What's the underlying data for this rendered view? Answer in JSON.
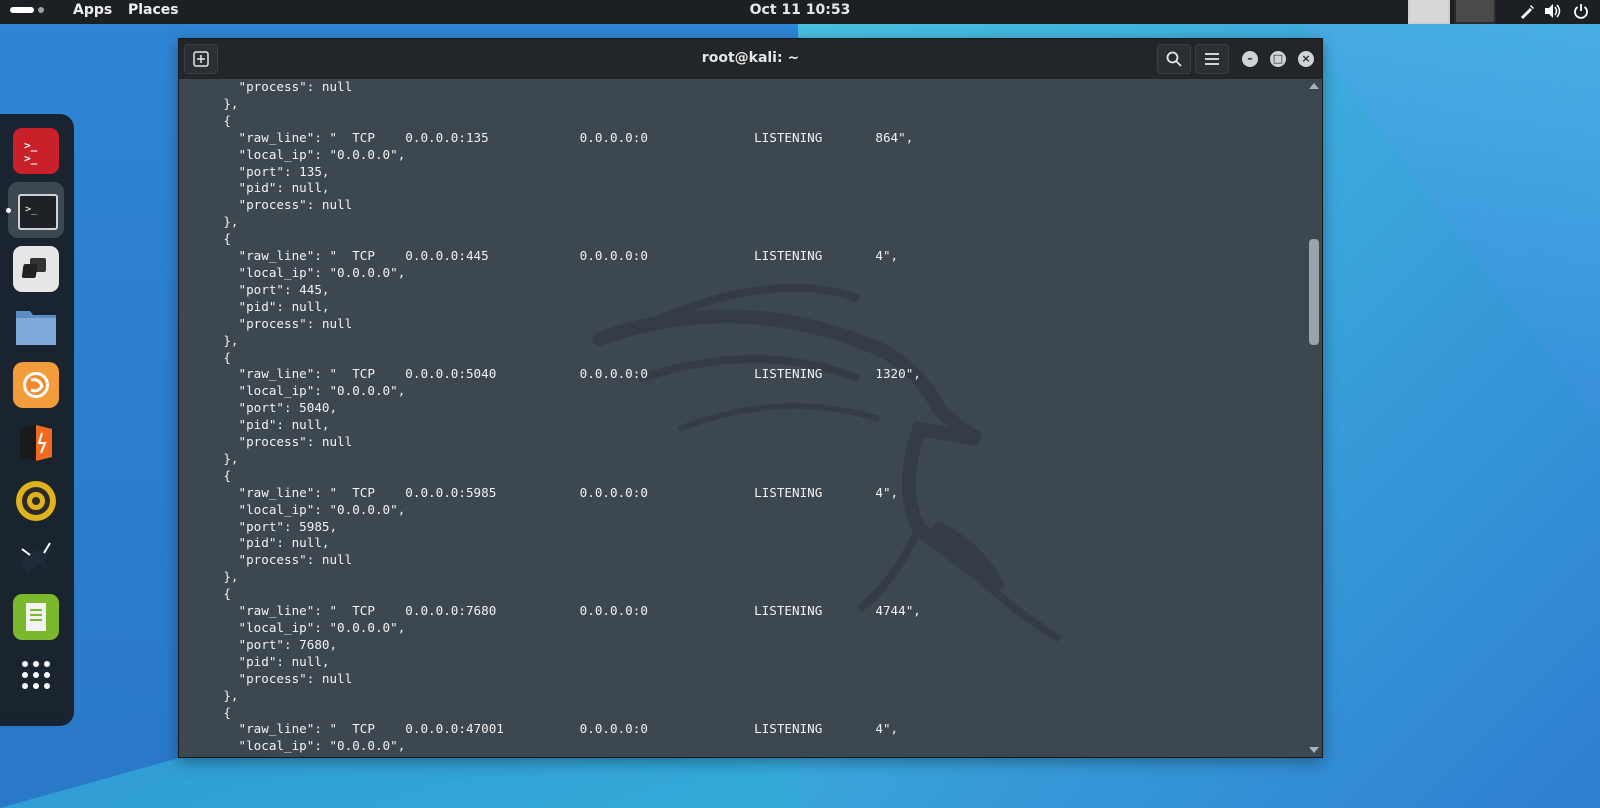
{
  "topbar": {
    "apps_label": "Apps",
    "places_label": "Places",
    "clock": "Oct 11  10:53"
  },
  "window": {
    "title": "root@kali: ~"
  },
  "terminal": {
    "lines": [
      "      \"process\": null",
      "    },",
      "    {",
      "      \"raw_line\": \"  TCP    0.0.0.0:135            0.0.0.0:0              LISTENING       864\",",
      "      \"local_ip\": \"0.0.0.0\",",
      "      \"port\": 135,",
      "      \"pid\": null,",
      "      \"process\": null",
      "    },",
      "    {",
      "      \"raw_line\": \"  TCP    0.0.0.0:445            0.0.0.0:0              LISTENING       4\",",
      "      \"local_ip\": \"0.0.0.0\",",
      "      \"port\": 445,",
      "      \"pid\": null,",
      "      \"process\": null",
      "    },",
      "    {",
      "      \"raw_line\": \"  TCP    0.0.0.0:5040           0.0.0.0:0              LISTENING       1320\",",
      "      \"local_ip\": \"0.0.0.0\",",
      "      \"port\": 5040,",
      "      \"pid\": null,",
      "      \"process\": null",
      "    },",
      "    {",
      "      \"raw_line\": \"  TCP    0.0.0.0:5985           0.0.0.0:0              LISTENING       4\",",
      "      \"local_ip\": \"0.0.0.0\",",
      "      \"port\": 5985,",
      "      \"pid\": null,",
      "      \"process\": null",
      "    },",
      "    {",
      "      \"raw_line\": \"  TCP    0.0.0.0:7680           0.0.0.0:0              LISTENING       4744\",",
      "      \"local_ip\": \"0.0.0.0\",",
      "      \"port\": 7680,",
      "      \"pid\": null,",
      "      \"process\": null",
      "    },",
      "    {",
      "      \"raw_line\": \"  TCP    0.0.0.0:47001          0.0.0.0:0              LISTENING       4\",",
      "      \"local_ip\": \"0.0.0.0\","
    ]
  },
  "dock": {
    "items": [
      "terminal-red-icon",
      "terminal-icon",
      "remote-desktop-icon",
      "files-icon",
      "firefox-icon",
      "burpsuite-icon",
      "radar-icon",
      "metasploit-icon",
      "text-editor-icon",
      "app-grid-icon"
    ]
  }
}
